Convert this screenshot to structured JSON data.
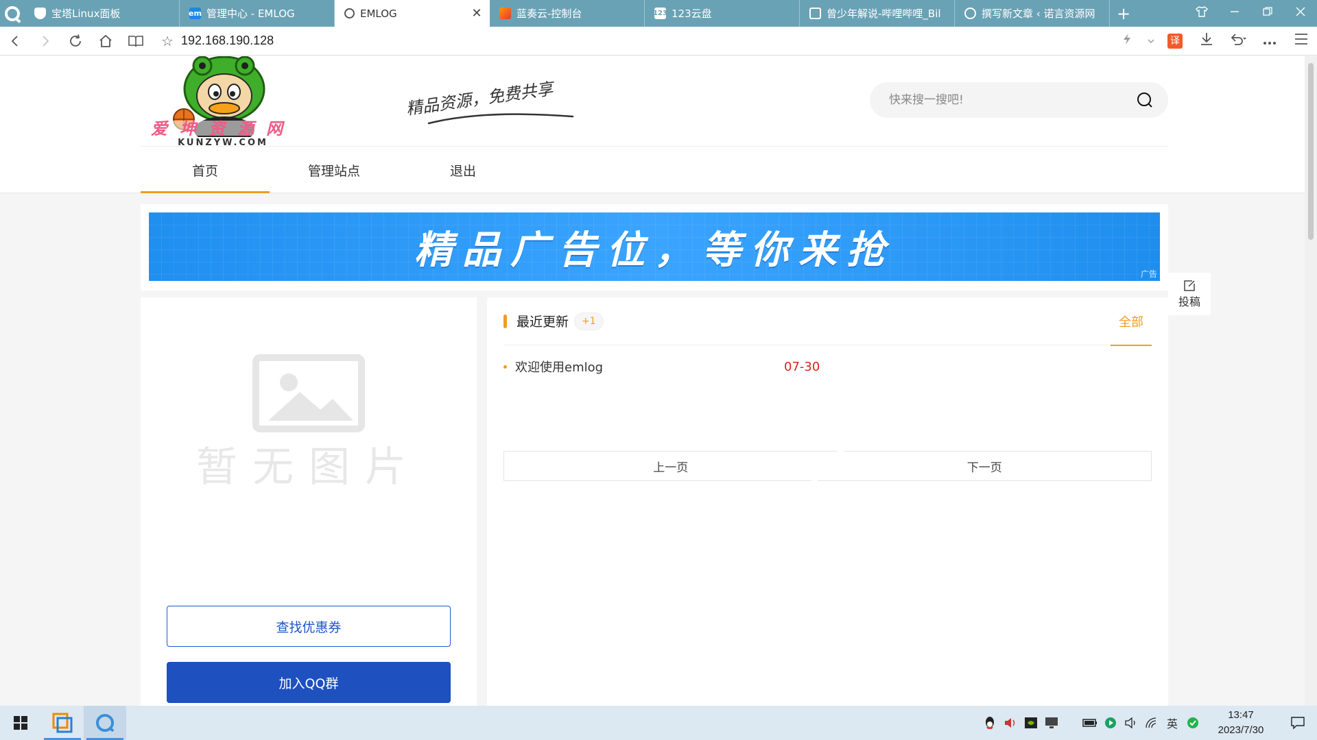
{
  "browser": {
    "tabs": [
      {
        "label": "宝塔Linux面板",
        "icon": "shield-icon",
        "active": false
      },
      {
        "label": "管理中心 - EMLOG",
        "icon": "em-icon",
        "active": false
      },
      {
        "label": "EMLOG",
        "icon": "globe-icon",
        "active": true
      },
      {
        "label": "蓝奏云-控制台",
        "icon": "lanzou-icon",
        "active": false
      },
      {
        "label": "123云盘",
        "icon": "123-icon",
        "active": false
      },
      {
        "label": "曾少年解说-哔哩哔哩_Bil",
        "icon": "bilibili-icon",
        "active": false
      },
      {
        "label": "撰写新文章 ‹ 诺言资源网",
        "icon": "wordpress-icon",
        "active": false
      }
    ],
    "close_glyph": "✕",
    "new_tab_glyph": "+",
    "url": "192.168.190.128",
    "translate_badge": "译"
  },
  "site": {
    "logo_watermark": "KUNZYW.COM",
    "slogan": "精品资源，免费共享",
    "search": {
      "placeholder": "快来搜一搜吧!",
      "value": ""
    },
    "nav": [
      {
        "label": "首页",
        "active": true
      },
      {
        "label": "管理站点",
        "active": false
      },
      {
        "label": "退出",
        "active": false
      }
    ],
    "banner": {
      "text": "精品广告位，等你来抢",
      "ad_tag": "广告"
    },
    "side_post_label": "投稿",
    "no_image_text": "暂无图片",
    "buttons": {
      "coupon": "查找优惠券",
      "qq_group": "加入QQ群"
    },
    "recent": {
      "title": "最近更新",
      "badge": "+1",
      "all_label": "全部",
      "posts": [
        {
          "title": "欢迎使用emlog",
          "date": "07-30"
        }
      ],
      "prev_label": "上一页",
      "next_label": "下一页"
    },
    "colors": {
      "accent": "#f29c1f",
      "primary_button": "#1e50c0",
      "date": "#e02020",
      "tabbar": "#6aa2b5"
    }
  },
  "taskbar": {
    "time": "13:47",
    "date": "2023/7/30",
    "ime": "英"
  }
}
